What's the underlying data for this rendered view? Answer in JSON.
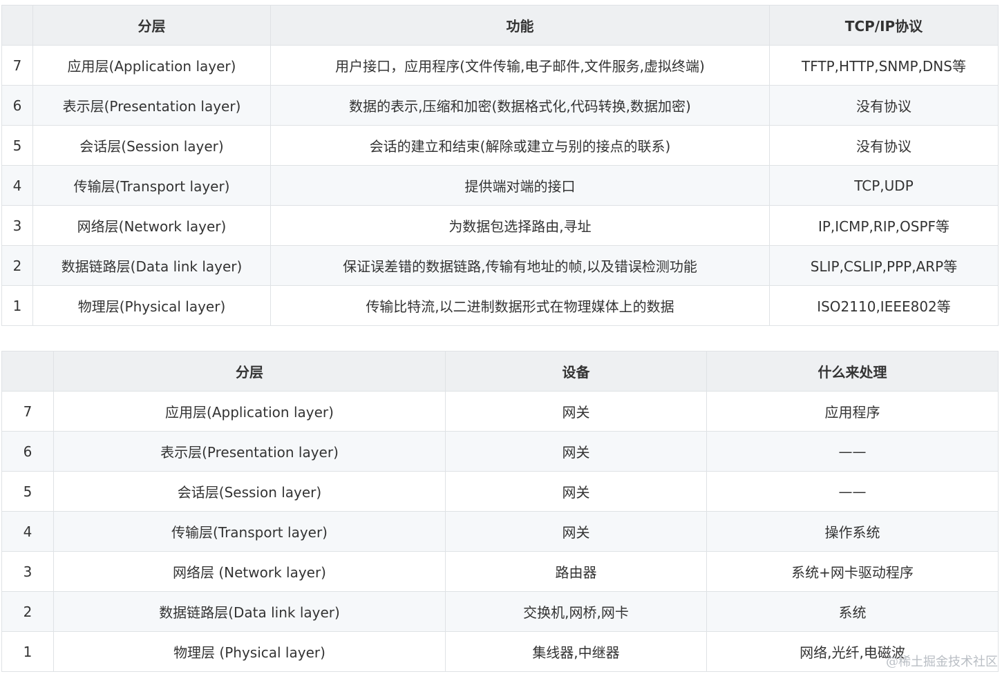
{
  "table1": {
    "headers": [
      "",
      "分层",
      "功能",
      "TCP/IP协议"
    ],
    "rows": [
      [
        "7",
        "应用层(Application layer)",
        "用户接口，应用程序(文件传输,电子邮件,文件服务,虚拟终端)",
        "TFTP,HTTP,SNMP,DNS等"
      ],
      [
        "6",
        "表示层(Presentation layer)",
        "数据的表示,压缩和加密(数据格式化,代码转换,数据加密)",
        "没有协议"
      ],
      [
        "5",
        "会话层(Session layer)",
        "会话的建立和结束(解除或建立与别的接点的联系)",
        "没有协议"
      ],
      [
        "4",
        "传输层(Transport layer)",
        "提供端对端的接口",
        "TCP,UDP"
      ],
      [
        "3",
        "网络层(Network layer)",
        "为数据包选择路由,寻址",
        "IP,ICMP,RIP,OSPF等"
      ],
      [
        "2",
        "数据链路层(Data link layer)",
        "保证误差错的数据链路,传输有地址的帧,以及错误检测功能",
        "SLIP,CSLIP,PPP,ARP等"
      ],
      [
        "1",
        "物理层(Physical layer)",
        "传输比特流,以二进制数据形式在物理媒体上的数据",
        "ISO2110,IEEE802等"
      ]
    ]
  },
  "table2": {
    "headers": [
      "",
      "分层",
      "设备",
      "什么来处理"
    ],
    "rows": [
      [
        "7",
        "应用层(Application layer)",
        "网关",
        "应用程序"
      ],
      [
        "6",
        "表示层(Presentation layer)",
        "网关",
        "——"
      ],
      [
        "5",
        "会话层(Session layer)",
        "网关",
        "——"
      ],
      [
        "4",
        "传输层(Transport layer)",
        "网关",
        "操作系统"
      ],
      [
        "3",
        "网络层 (Network layer)",
        "路由器",
        "系统+网卡驱动程序"
      ],
      [
        "2",
        "数据链路层(Data link layer)",
        "交换机,网桥,网卡",
        "系统"
      ],
      [
        "1",
        "物理层 (Physical layer)",
        "集线器,中继器",
        "网络,光纤,电磁波"
      ]
    ]
  },
  "watermark": "@稀土掘金技术社区"
}
